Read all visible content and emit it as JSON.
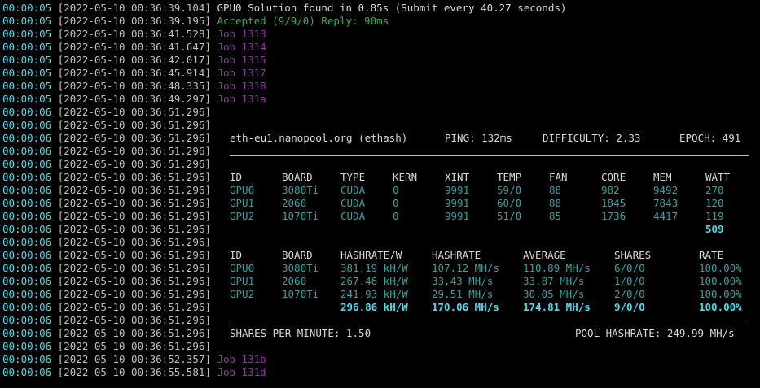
{
  "log": [
    {
      "uptime": "00:00:05",
      "ts": "[2022-05-10 00:36:39.104]",
      "msg": "GPU0 Solution found in 0.85s (Submit every 40.27 seconds)",
      "kind": "white"
    },
    {
      "uptime": "00:00:05",
      "ts": "[2022-05-10 00:36:39.195]",
      "msg": "Accepted (9/9/0) Reply: 90ms",
      "kind": "green"
    },
    {
      "uptime": "00:00:05",
      "ts": "[2022-05-10 00:36:41.528]",
      "msg": "Job 1313",
      "kind": "purple"
    },
    {
      "uptime": "00:00:05",
      "ts": "[2022-05-10 00:36:41.647]",
      "msg": "Job 1314",
      "kind": "purple"
    },
    {
      "uptime": "00:00:05",
      "ts": "[2022-05-10 00:36:42.017]",
      "msg": "Job 1315",
      "kind": "purple"
    },
    {
      "uptime": "00:00:05",
      "ts": "[2022-05-10 00:36:45.914]",
      "msg": "Job 1317",
      "kind": "purple"
    },
    {
      "uptime": "00:00:05",
      "ts": "[2022-05-10 00:36:48.335]",
      "msg": "Job 1318",
      "kind": "purple"
    },
    {
      "uptime": "00:00:05",
      "ts": "[2022-05-10 00:36:49.297]",
      "msg": "Job 131a",
      "kind": "purple"
    },
    {
      "uptime": "00:00:06",
      "ts": "[2022-05-10 00:36:51.296]",
      "msg": "",
      "kind": "white"
    },
    {
      "uptime": "00:00:06",
      "ts": "[2022-05-10 00:36:51.296]",
      "msg": "",
      "kind": "white"
    },
    {
      "uptime": "00:00:06",
      "ts": "[2022-05-10 00:36:51.296]",
      "msg": "",
      "kind": "white"
    },
    {
      "uptime": "00:00:06",
      "ts": "[2022-05-10 00:36:51.296]",
      "msg": "",
      "kind": "white"
    },
    {
      "uptime": "00:00:06",
      "ts": "[2022-05-10 00:36:51.296]",
      "msg": "",
      "kind": "white"
    },
    {
      "uptime": "00:00:06",
      "ts": "[2022-05-10 00:36:51.296]",
      "msg": "",
      "kind": "white"
    },
    {
      "uptime": "00:00:06",
      "ts": "[2022-05-10 00:36:51.296]",
      "msg": "",
      "kind": "white"
    },
    {
      "uptime": "00:00:06",
      "ts": "[2022-05-10 00:36:51.296]",
      "msg": "",
      "kind": "white"
    },
    {
      "uptime": "00:00:06",
      "ts": "[2022-05-10 00:36:51.296]",
      "msg": "",
      "kind": "white"
    },
    {
      "uptime": "00:00:06",
      "ts": "[2022-05-10 00:36:51.296]",
      "msg": "",
      "kind": "white"
    },
    {
      "uptime": "00:00:06",
      "ts": "[2022-05-10 00:36:51.296]",
      "msg": "",
      "kind": "white"
    },
    {
      "uptime": "00:00:06",
      "ts": "[2022-05-10 00:36:51.296]",
      "msg": "",
      "kind": "white"
    },
    {
      "uptime": "00:00:06",
      "ts": "[2022-05-10 00:36:51.296]",
      "msg": "",
      "kind": "white"
    },
    {
      "uptime": "00:00:06",
      "ts": "[2022-05-10 00:36:51.296]",
      "msg": "",
      "kind": "white"
    },
    {
      "uptime": "00:00:06",
      "ts": "[2022-05-10 00:36:51.296]",
      "msg": "",
      "kind": "white"
    },
    {
      "uptime": "00:00:06",
      "ts": "[2022-05-10 00:36:51.296]",
      "msg": "",
      "kind": "white"
    },
    {
      "uptime": "00:00:06",
      "ts": "[2022-05-10 00:36:51.296]",
      "msg": "",
      "kind": "white"
    },
    {
      "uptime": "00:00:06",
      "ts": "[2022-05-10 00:36:51.296]",
      "msg": "",
      "kind": "white"
    },
    {
      "uptime": "00:00:06",
      "ts": "[2022-05-10 00:36:51.296]",
      "msg": "",
      "kind": "white"
    },
    {
      "uptime": "00:00:06",
      "ts": "[2022-05-10 00:36:52.357]",
      "msg": "Job 131b",
      "kind": "purple"
    },
    {
      "uptime": "00:00:06",
      "ts": "[2022-05-10 00:36:55.581]",
      "msg": "Job 131d",
      "kind": "purple"
    }
  ],
  "pool": {
    "host": "eth-eu1.nanopool.org (ethash)",
    "ping": "PING: 132ms",
    "difficulty": "DIFFICULTY: 2.33",
    "epoch": "EPOCH: 491"
  },
  "gpu_table": {
    "headers": [
      "ID",
      "BOARD",
      "TYPE",
      "KERN",
      "XINT",
      "TEMP",
      "FAN",
      "CORE",
      "MEM",
      "WATT"
    ],
    "rows": [
      [
        "GPU0",
        "3080Ti",
        "CUDA",
        "0",
        "9991",
        "59/0",
        "88",
        "982",
        "9492",
        "270"
      ],
      [
        "GPU1",
        "2060",
        "CUDA",
        "0",
        "9991",
        "60/0",
        "88",
        "1845",
        "7843",
        "120"
      ],
      [
        "GPU2",
        "1070Ti",
        "CUDA",
        "0",
        "9991",
        "51/0",
        "85",
        "1736",
        "4417",
        "119"
      ]
    ],
    "total_watt": "509"
  },
  "hash_table": {
    "headers": [
      "ID",
      "BOARD",
      "HASHRATE/W",
      "HASHRATE",
      "AVERAGE",
      "SHARES",
      "RATE"
    ],
    "rows": [
      [
        "GPU0",
        "3080Ti",
        "381.19 kH/W",
        "107.12 MH/s",
        "110.89 MH/s",
        "6/0/0",
        "100.00%"
      ],
      [
        "GPU1",
        "2060",
        "267.46 kH/W",
        "33.43 MH/s",
        "33.87 MH/s",
        "1/0/0",
        "100.00%"
      ],
      [
        "GPU2",
        "1070Ti",
        "241.93 kH/W",
        "29.51 MH/s",
        "30.05 MH/s",
        "2/0/0",
        "100.00%"
      ]
    ],
    "totals": [
      "",
      "",
      "296.86 kH/W",
      "170.06 MH/s",
      "174.81 MH/s",
      "9/0/0",
      "100.00%"
    ]
  },
  "footer": {
    "shares_per_minute": "SHARES PER MINUTE: 1.50",
    "pool_hashrate": "POOL HASHRATE: 249.99 MH/s"
  },
  "colors": {
    "background": "#000000",
    "uptime": "#40e0f0",
    "accepted": "#3cb043",
    "job": "#9b2fae",
    "gpu_row": "#2aa5a5"
  }
}
